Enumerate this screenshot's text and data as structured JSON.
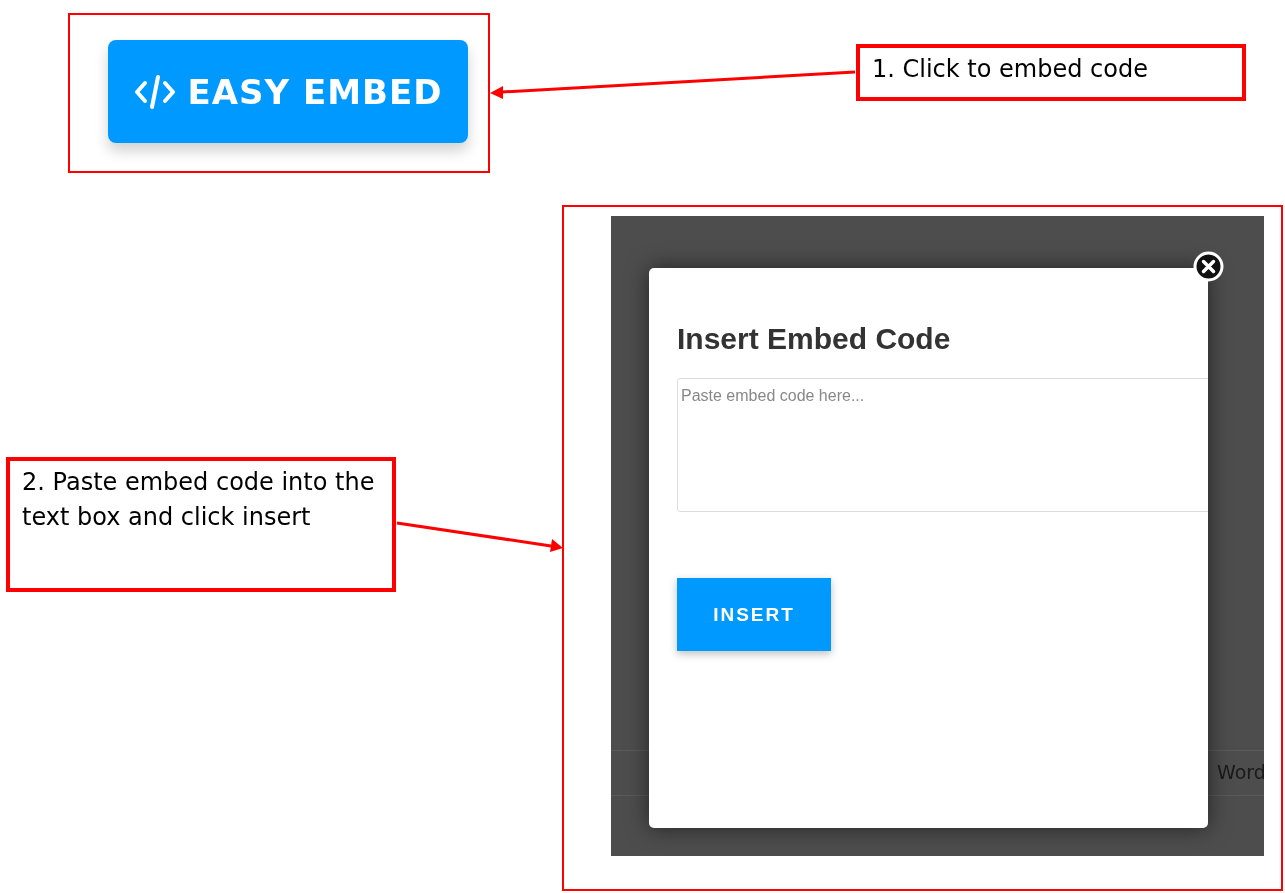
{
  "embed_button": {
    "label": "EASY EMBED"
  },
  "callouts": [
    {
      "text": "1. Click to embed code"
    },
    {
      "text": "2. Paste embed code into the text box and click insert"
    }
  ],
  "background": {
    "text": "Word"
  },
  "modal": {
    "title": "Insert Embed Code",
    "textarea": {
      "placeholder": "Paste embed code here..."
    },
    "insert_button": "INSERT"
  }
}
